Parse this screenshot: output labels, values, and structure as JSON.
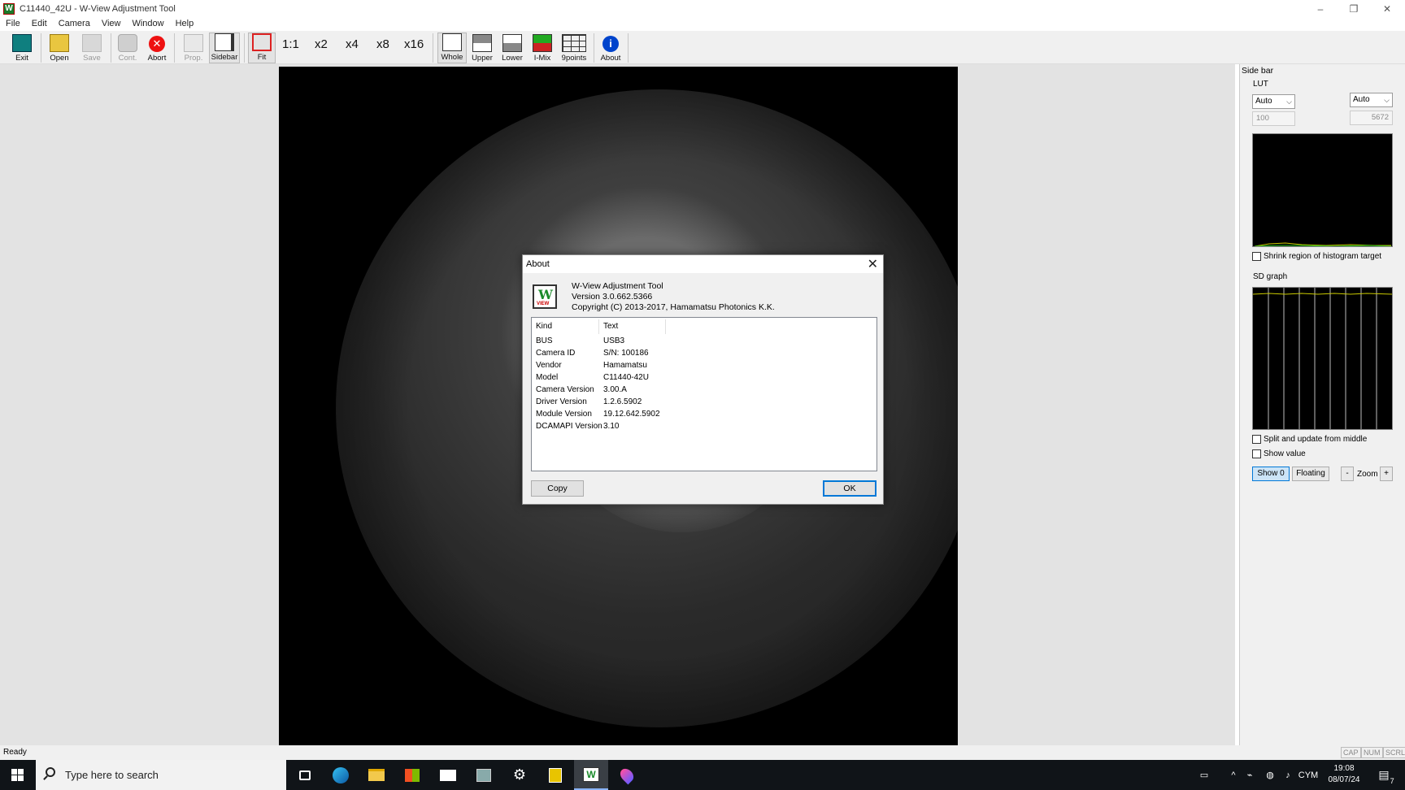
{
  "window": {
    "title": "C11440_42U - W-View Adjustment Tool",
    "app_icon": "W"
  },
  "window_controls": {
    "minimize": "–",
    "maximize": "❐",
    "close": "✕"
  },
  "menu": [
    "File",
    "Edit",
    "Camera",
    "View",
    "Window",
    "Help"
  ],
  "toolbar": {
    "exit": "Exit",
    "open": "Open",
    "save": "Save",
    "cont": "Cont.",
    "abort": "Abort",
    "prop": "Prop.",
    "sidebar": "Sidebar",
    "fit": "Fit",
    "zoom_1": "1:1",
    "zoom_2": "x2",
    "zoom_4": "x4",
    "zoom_8": "x8",
    "zoom_16": "x16",
    "whole": "Whole",
    "upper": "Upper",
    "lower": "Lower",
    "imix": "I-Mix",
    "ninepoints": "9points",
    "about": "About"
  },
  "sidebar": {
    "header": "Side bar",
    "lut_label": "LUT",
    "lut_left_mode": "Auto",
    "lut_right_mode": "Auto",
    "lut_min": "100",
    "lut_max": "5672",
    "shrink_histogram": "Shrink region of histogram target",
    "sd_graph_label": "SD graph",
    "split_update": "Split and update from middle",
    "show_value": "Show value",
    "show0": "Show 0",
    "floating": "Floating",
    "zoom_minus": "-",
    "zoom_label": "Zoom",
    "zoom_plus": "+"
  },
  "status": {
    "text": "Ready",
    "cap": "CAP",
    "num": "NUM",
    "scrl": "SCRL"
  },
  "about_dialog": {
    "title": "About",
    "close": "✕",
    "logo_text": "W",
    "logo_subtext": "VIEW",
    "app_name": "W-View Adjustment Tool",
    "version": "Version 3.0.662.5366",
    "copyright": "Copyright (C) 2013-2017, Hamamatsu Photonics K.K.",
    "columns": [
      "Kind",
      "Text"
    ],
    "rows": [
      {
        "kind": "BUS",
        "text": "USB3"
      },
      {
        "kind": "Camera ID",
        "text": "S/N: 100186"
      },
      {
        "kind": "Vendor",
        "text": "Hamamatsu"
      },
      {
        "kind": "Model",
        "text": "C11440-42U"
      },
      {
        "kind": "Camera Version",
        "text": "3.00.A"
      },
      {
        "kind": "Driver Version",
        "text": "1.2.6.5902"
      },
      {
        "kind": "Module Version",
        "text": "19.12.642.5902"
      },
      {
        "kind": "DCAMAPI Version",
        "text": "3.10"
      }
    ],
    "copy_button": "Copy",
    "ok_button": "OK"
  },
  "taskbar": {
    "search_placeholder": "Type here to search",
    "apps": [
      "task-view-icon",
      "edge-icon",
      "file-explorer-icon",
      "store-icon",
      "mail-icon",
      "app-icon",
      "settings-icon",
      "calculator-icon",
      "wview-icon",
      "maps-icon"
    ],
    "language": "CYM",
    "time": "19:08",
    "date": "08/07/24",
    "notification_count": "7"
  },
  "colors": {
    "accent": "#0078d7",
    "taskbar": "#101418",
    "toolbar_bg": "#f0f0f0",
    "viewport_bg": "#e3e3e3"
  }
}
